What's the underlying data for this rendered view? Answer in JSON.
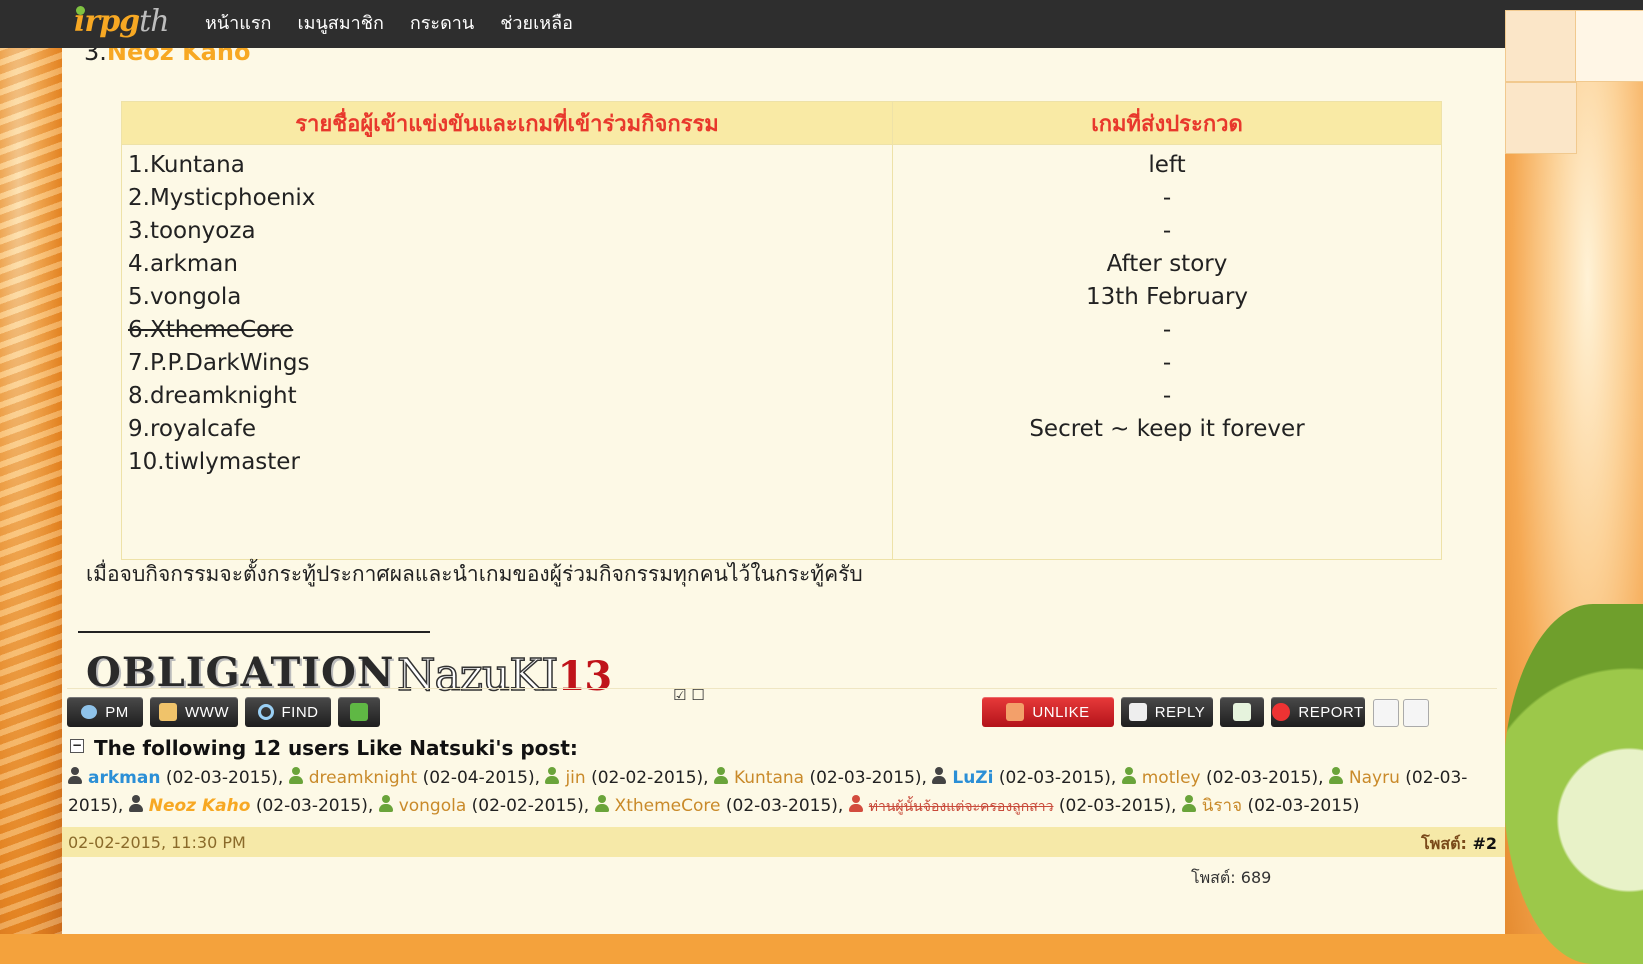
{
  "nav": {
    "logo_text": "irpg",
    "logo_suffix": "th",
    "items": [
      "หน้าแรก",
      "เมนูสมาชิก",
      "กระดาน",
      "ช่วยเหลือ"
    ]
  },
  "post": {
    "heading_prefix": "3.",
    "heading_name": "Neoz Kaho",
    "table": {
      "col1_header": "รายชื่อผู้เข้าแข่งขันและเกมที่เข้าร่วมกิจกรรม",
      "col2_header": "เกมที่ส่งประกวด",
      "players": [
        "1.Kuntana",
        "2.Mysticphoenix",
        "3.toonyoza",
        "4.arkman",
        "5.vongola",
        "6.XthemeCore",
        "7.P.P.DarkWings",
        "8.dreamknight",
        "9.royalcafe",
        "10.tiwlymaster"
      ],
      "games": [
        "left",
        "-",
        "-",
        "After story",
        "13th February",
        "-",
        "-",
        "-",
        "Secret ~ keep it forever",
        ""
      ]
    },
    "notice": "เมื่อจบกิจกรรมจะตั้งกระทู้ประกาศผลและนำเกมของผู้ร่วมกิจกรรมทุกคนไว้ในกระทู้ครับ",
    "signature": {
      "obligation": "OBLIGATION",
      "nazuki": "NazuKI",
      "nazuki_num": "13",
      "boxes": "☑ ☐"
    }
  },
  "toolbar": {
    "pm": "PM",
    "www": "WWW",
    "find": "FIND",
    "unlike": "UNLIKE",
    "reply": "REPLY",
    "report": "REPORT"
  },
  "likes": {
    "title": "The following 12 users Like Natsuki's post:",
    "entries": [
      {
        "user": "arkman",
        "date": "(02-03-2015),"
      },
      {
        "user": "dreamknight",
        "date": "(02-04-2015),"
      },
      {
        "user": "jin",
        "date": "(02-02-2015),"
      },
      {
        "user": "Kuntana",
        "date": "(02-03-2015),"
      },
      {
        "user": "LuZi",
        "date": "(02-03-2015),"
      },
      {
        "user": "motley",
        "date": "(02-03-2015),"
      },
      {
        "user": "Nayru",
        "date": "(02-03-2015),"
      },
      {
        "user": "Neoz Kaho",
        "date": "(02-03-2015),"
      },
      {
        "user": "vongola",
        "date": "(02-02-2015),"
      },
      {
        "user": "XthemeCore",
        "date": "(02-03-2015),"
      },
      {
        "user": "ท่านผู้นั้นจ้องแต่จะครองลูกสาว",
        "date": "(02-03-2015),"
      },
      {
        "user": "นิราจ",
        "date": "(02-03-2015)"
      }
    ]
  },
  "next_post": {
    "date": "02-02-2015, 11:30 PM",
    "label": "โพสต์:",
    "number": "#2",
    "post_count": "โพสต์: 689"
  }
}
